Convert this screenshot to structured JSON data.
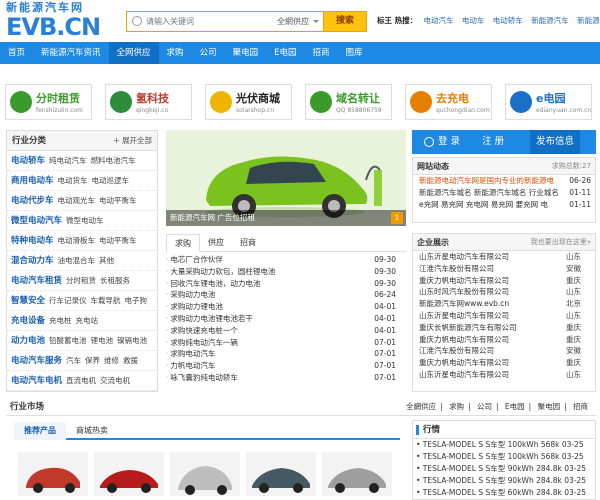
{
  "header": {
    "logo_cn": "新能源汽车网",
    "logo_en": "EVB.CN",
    "search_placeholder": "请输入关键词",
    "search_scope": "全網供应",
    "search_button": "搜索",
    "hot_label": "标王 热搜：",
    "hot_items": [
      "电动汽车",
      "电动车",
      "电动轿车",
      "新能源汽车",
      "新能源",
      "锂"
    ]
  },
  "nav": [
    "首页",
    "新能源汽车资讯",
    "全网供应",
    "求购",
    "公司",
    "聚电园",
    "E电园",
    "招商",
    "图库"
  ],
  "partners": [
    {
      "title": "分时租赁",
      "sub": "fenshizulin.com",
      "color": "#3a9a2a"
    },
    {
      "title": "氢科技",
      "sub": "qingkeji.cn",
      "color": "#c0392b"
    },
    {
      "title": "光伏商城",
      "sub": "solarshop.cn",
      "color": "#222222"
    },
    {
      "title": "域名转让",
      "sub": "QQ 858806759",
      "color": "#3a9a2a"
    },
    {
      "title": "去充电",
      "sub": "quchongdian.com",
      "color": "#e67e00"
    },
    {
      "title": "e电园",
      "sub": "edianyuan.com.cn",
      "color": "#1a6fc6"
    }
  ],
  "sidebar": {
    "title": "行业分类",
    "expand": "+ 展开全部",
    "categories": [
      {
        "main": "电动轿车",
        "subs": [
          "纯电动汽车",
          "燃料电池汽车"
        ]
      },
      {
        "main": "商用电动车",
        "subs": [
          "电动货车",
          "电动巡逻车"
        ]
      },
      {
        "main": "电动代步车",
        "subs": [
          "电动观光车",
          "电动平衡车"
        ]
      },
      {
        "main": "微型电动汽车",
        "subs": [
          "微型电动车"
        ]
      },
      {
        "main": "特种电动车",
        "subs": [
          "电动滑板车",
          "电动平衡车"
        ]
      },
      {
        "main": "混合动力车",
        "subs": [
          "油电混合车",
          "其他"
        ]
      },
      {
        "main": "电动汽车租赁",
        "subs": [
          "分时租赁",
          "长租服务"
        ]
      },
      {
        "main": "智慧安全",
        "subs": [
          "行车记录仪",
          "车载导航",
          "电子狗"
        ]
      },
      {
        "main": "充电设备",
        "subs": [
          "充电桩",
          "充电站"
        ]
      },
      {
        "main": "动力电池",
        "subs": [
          "铅酸蓄电池",
          "锂电池",
          "镍镉电池"
        ]
      },
      {
        "main": "电动汽车服务",
        "subs": [
          "汽车",
          "保养",
          "维修",
          "救援"
        ]
      },
      {
        "main": "电动汽车电机",
        "subs": [
          "直流电机",
          "交流电机"
        ]
      }
    ]
  },
  "banner_caption": "新能源汽车网 广告位招租",
  "banner_index": "1",
  "tabs": [
    "求购",
    "供应",
    "招商"
  ],
  "news": [
    {
      "title": "电芯厂合作伙伴",
      "date": "09-30"
    },
    {
      "title": "大量采购动力软包，圆柱锂电池",
      "date": "09-30"
    },
    {
      "title": "回收汽车锂电池，动力电池",
      "date": "09-30"
    },
    {
      "title": "采购动力电池",
      "date": "06-24"
    },
    {
      "title": "求购动力锂电池",
      "date": "04-01"
    },
    {
      "title": "求购动力电池锂电池若干",
      "date": "04-01"
    },
    {
      "title": "求购快速充电桩一个",
      "date": "04-01"
    },
    {
      "title": "求购纯电动汽车一辆",
      "date": "07-01"
    },
    {
      "title": "求购电动汽车",
      "date": "07-01"
    },
    {
      "title": "力帆电动汽车",
      "date": "07-01"
    },
    {
      "title": "咏飞囊豹纯电动轿车",
      "date": "07-01"
    }
  ],
  "actions": {
    "login": "登 录",
    "register": "注 册",
    "publish": "发布信息"
  },
  "dynamics": {
    "title": "网站动态",
    "count": "求购总数:27",
    "items": [
      {
        "text": "新能源电动汽车网是国内专业的新能源电",
        "date": "06-26",
        "highlight": true
      },
      {
        "text": "新能源汽车城名  新能源汽车城名  行业城名",
        "date": "01-11",
        "highlight": false
      },
      {
        "text": "e充网  易充网  充电网  易充网  要充网  电",
        "date": "01-11",
        "highlight": false
      }
    ]
  },
  "firms": {
    "title": "企业展示",
    "more": "我也要出现在这里»",
    "items": [
      {
        "name": "山东沂星电动汽车有限公司",
        "loc": "山东"
      },
      {
        "name": "江淮汽车股份有限公司",
        "loc": "安徽"
      },
      {
        "name": "重庆力帆电动汽车有限公司",
        "loc": "重庆"
      },
      {
        "name": "山东时风汽车股份有限公司",
        "loc": "山东"
      },
      {
        "name": "新能源汽车网www.evb.cn",
        "loc": "北京"
      },
      {
        "name": "山东沂星电动汽车有限公司",
        "loc": "山东"
      },
      {
        "name": "重庆长帆新能源汽车有限公司",
        "loc": "重庆"
      },
      {
        "name": "重庆力帆电动汽车有限公司",
        "loc": "重庆"
      },
      {
        "name": "江淮汽车股份有限公司",
        "loc": "安徽"
      },
      {
        "name": "重庆力帆电动汽车有限公司",
        "loc": "重庆"
      },
      {
        "name": "山东沂星电动汽车有限公司",
        "loc": "山东"
      }
    ]
  },
  "market": {
    "title": "行业市场",
    "links": [
      "全網供应",
      "求购",
      "公司",
      "E电园",
      "聚电园",
      "招商"
    ]
  },
  "products": {
    "tabs": [
      "推荐产品",
      "商城热卖"
    ],
    "car_colors": [
      "#c0392b",
      "#b71c1c",
      "#bdbdbd",
      "#455a64",
      "#9e9e9e"
    ]
  },
  "quotes": {
    "title": "行情",
    "items": [
      "• TESLA-MODEL S S车型 100kWh 568k 03-25",
      "• TESLA-MODEL S S车型 100kWh 568k 03-25",
      "• TESLA-MODEL S S车型 90kWh 284.8k 03-25",
      "• TESLA-MODEL S S车型 90kWh 284.8k 03-25",
      "• TESLA-MODEL S S车型 60kWh 284.8k 03-25"
    ]
  }
}
